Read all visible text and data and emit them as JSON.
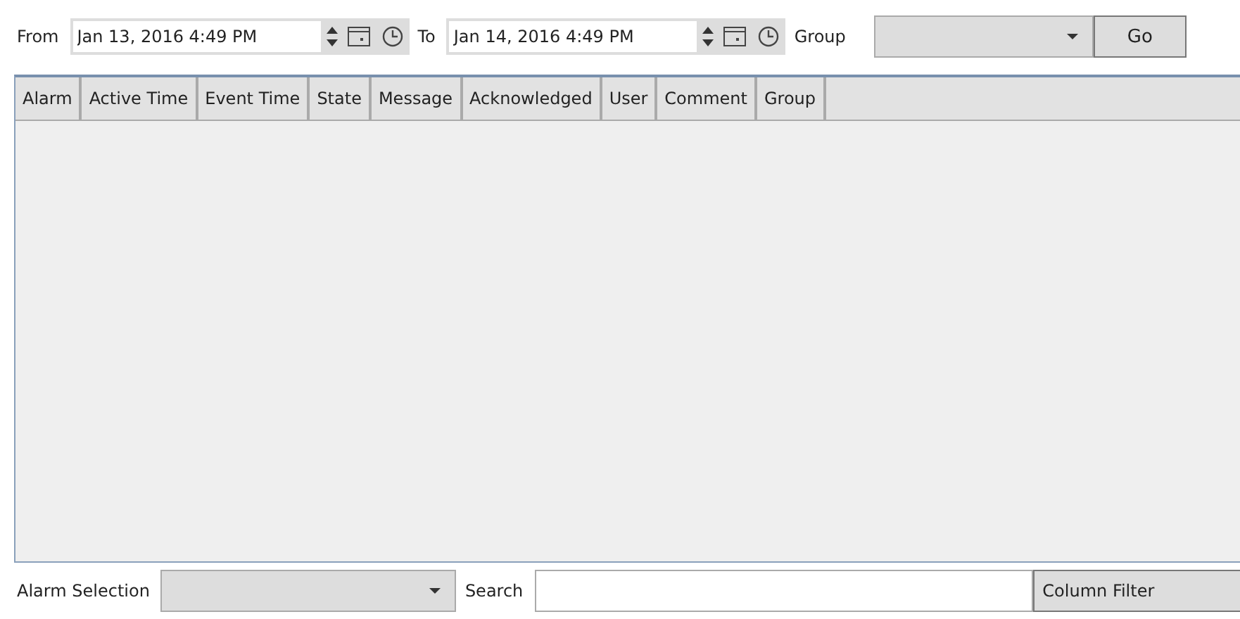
{
  "filter_bar": {
    "from_label": "From",
    "from_value": "Jan 13, 2016 4:49 PM",
    "to_label": "To",
    "to_value": "Jan 14, 2016 4:49 PM",
    "group_label": "Group",
    "go_button": "Go"
  },
  "table": {
    "columns": [
      "Alarm",
      "Active Time",
      "Event Time",
      "State",
      "Message",
      "Acknowledged",
      "User",
      "Comment",
      "Group"
    ]
  },
  "bottom_bar": {
    "alarm_selection_label": "Alarm Selection",
    "search_label": "Search",
    "column_filters_button": "Column Filter"
  }
}
